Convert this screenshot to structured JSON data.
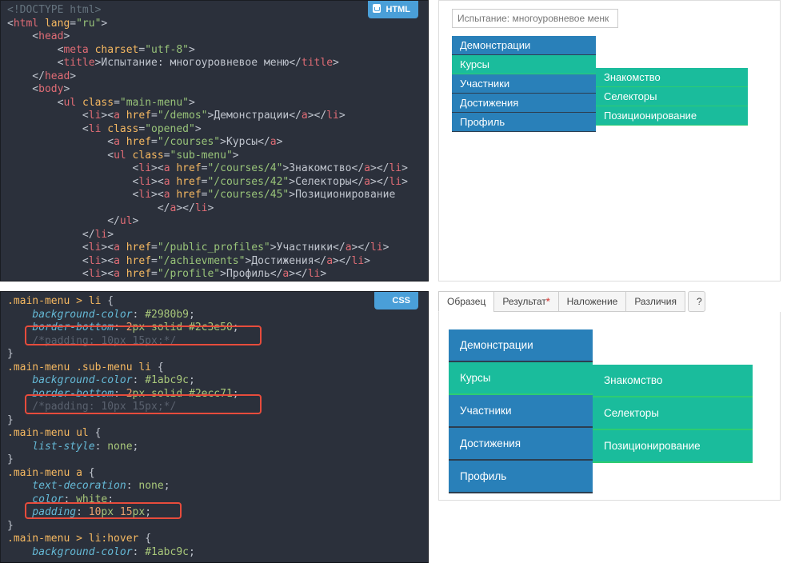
{
  "badges": {
    "html": "HTML",
    "css": "CSS"
  },
  "htmlCode": {
    "l1": "<!DOCTYPE html>",
    "l2a": "<",
    "l2b": "html ",
    "l2c": "lang",
    "l2d": "=",
    "l2e": "\"ru\"",
    "l2f": ">",
    "l3a": "    <",
    "l3b": "head",
    "l3c": ">",
    "l4a": "        <",
    "l4b": "meta ",
    "l4c": "charset",
    "l4d": "=",
    "l4e": "\"utf-8\"",
    "l4f": ">",
    "l5a": "        <",
    "l5b": "title",
    "l5c": ">",
    "l5d": "Испытание: многоуровневое меню",
    "l5e": "</",
    "l5f": "title",
    "l5g": ">",
    "l6a": "    </",
    "l6b": "head",
    "l6c": ">",
    "l7a": "    <",
    "l7b": "body",
    "l7c": ">",
    "l8a": "        <",
    "l8b": "ul ",
    "l8c": "class",
    "l8d": "=",
    "l8e": "\"main-menu\"",
    "l8f": ">",
    "l9a": "            <",
    "l9b": "li",
    "l9c": "><",
    "l9d": "a ",
    "l9e": "href",
    "l9f": "=",
    "l9g": "\"/demos\"",
    "l9h": ">",
    "l9i": "Демонстрации",
    "l9j": "</",
    "l9k": "a",
    "l9l": "></",
    "l9m": "li",
    "l9n": ">",
    "l10a": "            <",
    "l10b": "li ",
    "l10c": "class",
    "l10d": "=",
    "l10e": "\"opened\"",
    "l10f": ">",
    "l11a": "                <",
    "l11b": "a ",
    "l11c": "href",
    "l11d": "=",
    "l11e": "\"/courses\"",
    "l11f": ">",
    "l11g": "Курсы",
    "l11h": "</",
    "l11i": "a",
    "l11j": ">",
    "l12a": "                <",
    "l12b": "ul ",
    "l12c": "class",
    "l12d": "=",
    "l12e": "\"sub-menu\"",
    "l12f": ">",
    "l13a": "                    <",
    "l13b": "li",
    "l13c": "><",
    "l13d": "a ",
    "l13e": "href",
    "l13f": "=",
    "l13g": "\"/courses/4\"",
    "l13h": ">",
    "l13i": "Знакомство",
    "l13j": "</",
    "l13k": "a",
    "l13l": "></",
    "l13m": "li",
    "l13n": ">",
    "l14a": "                    <",
    "l14b": "li",
    "l14c": "><",
    "l14d": "a ",
    "l14e": "href",
    "l14f": "=",
    "l14g": "\"/courses/42\"",
    "l14h": ">",
    "l14i": "Селекторы",
    "l14j": "</",
    "l14k": "a",
    "l14l": "></",
    "l14m": "li",
    "l14n": ">",
    "l15a": "                    <",
    "l15b": "li",
    "l15c": "><",
    "l15d": "a ",
    "l15e": "href",
    "l15f": "=",
    "l15g": "\"/courses/45\"",
    "l15h": ">",
    "l15i": "Позиционирование",
    "l16a": "                        </",
    "l16b": "a",
    "l16c": "></",
    "l16d": "li",
    "l16e": ">",
    "l17a": "                </",
    "l17b": "ul",
    "l17c": ">",
    "l18a": "            </",
    "l18b": "li",
    "l18c": ">",
    "l19a": "            <",
    "l19b": "li",
    "l19c": "><",
    "l19d": "a ",
    "l19e": "href",
    "l19f": "=",
    "l19g": "\"/public_profiles\"",
    "l19h": ">",
    "l19i": "Участники",
    "l19j": "</",
    "l19k": "a",
    "l19l": "></",
    "l19m": "li",
    "l19n": ">",
    "l20a": "            <",
    "l20b": "li",
    "l20c": "><",
    "l20d": "a ",
    "l20e": "href",
    "l20f": "=",
    "l20g": "\"/achievments\"",
    "l20h": ">",
    "l20i": "Достижения",
    "l20j": "</",
    "l20k": "a",
    "l20l": "></",
    "l20m": "li",
    "l20n": ">",
    "l21a": "            <",
    "l21b": "li",
    "l21c": "><",
    "l21d": "a ",
    "l21e": "href",
    "l21f": "=",
    "l21g": "\"/profile\"",
    "l21h": ">",
    "l21i": "Профиль",
    "l21j": "</",
    "l21k": "a",
    "l21l": "></",
    "l21m": "li",
    "l21n": ">"
  },
  "cssCode": {
    "c1a": ".main-menu > li ",
    "c1b": "{",
    "c2a": "    background-color",
    "c2col": ": ",
    "c2b": "#2980b9",
    "c2c": ";",
    "c3a": "    border-bottom",
    "c3b": "2",
    "c3b2": "px ",
    "c3c": "solid ",
    "c3d": "#2c3e50",
    "c3e": ";",
    "c4": "    /*padding: 10px 15px;*/",
    "c5": "}",
    "c6a": ".main-menu .sub-menu li ",
    "c6b": "{",
    "c7a": "    background-color",
    "c7b": "#1abc9c",
    "c7c": ";",
    "c8a": "    border-bottom",
    "c8b": "2",
    "c8b2": "px ",
    "c8c": "solid ",
    "c8d": "#2ecc71",
    "c8e": ";",
    "c9": "    /*padding: 10px 15px;*/",
    "c10": "}",
    "c11a": ".main-menu ul ",
    "c11b": "{",
    "c12a": "    list-style",
    "c12b": "none",
    "c12c": ";",
    "c13": "}",
    "c14a": ".main-menu a ",
    "c14b": "{",
    "c15a": "    text-decoration",
    "c15b": "none",
    "c15c": ";",
    "c16a": "    color",
    "c16b": "white",
    "c16c": ";",
    "c17a": "    padding",
    "c17b": "10",
    "c17b2": "px ",
    "c17c": "15",
    "c17c2": "px",
    "c17d": ";",
    "c18": "}",
    "c19a": ".main-menu > li:hover ",
    "c19b": "{",
    "c20a": "    background-color",
    "c20b": "#1abc9c",
    "c20c": ";"
  },
  "preview": {
    "inputText": "Испытание: многоуровневое менк",
    "items": [
      "Демонстрации",
      "Курсы",
      "Участники",
      "Достижения",
      "Профиль"
    ],
    "sub": [
      "Знакомство",
      "Селекторы",
      "Позиционирование"
    ]
  },
  "tabs": {
    "t1": "Образец",
    "t2": "Результат",
    "t3": "Наложение",
    "t4": "Различия",
    "q": "?"
  },
  "sample": {
    "items": [
      "Демонстрации",
      "Курсы",
      "Участники",
      "Достижения",
      "Профиль"
    ],
    "sub": [
      "Знакомство",
      "Селекторы",
      "Позиционирование"
    ]
  }
}
